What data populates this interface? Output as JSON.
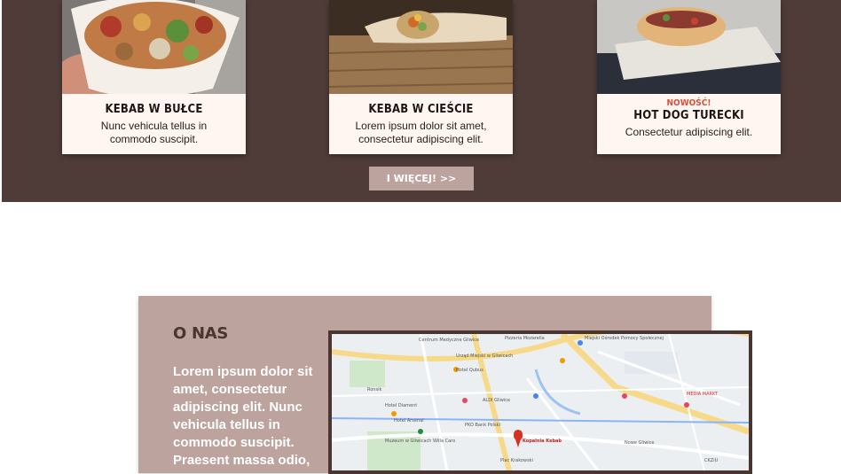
{
  "menu": {
    "cards": [
      {
        "badge": "",
        "title": "KEBAB W BUŁCE",
        "desc": "Nunc vehicula tellus in commodo suscipit."
      },
      {
        "badge": "",
        "title": "KEBAB W CIEŚCIE",
        "desc": "Lorem ipsum dolor sit amet, consectetur adipiscing elit."
      },
      {
        "badge": "NOWOŚĆ!",
        "title": "HOT DOG TURECKI",
        "desc": "Consectetur adipiscing elit."
      }
    ],
    "more_label": "I WIĘCEJ! >>"
  },
  "about": {
    "title": "O NAS",
    "text": "Lorem ipsum dolor sit amet, consectetur adipiscing elit. Nunc vehicula tellus in commodo suscipit. Praesent massa odio,"
  },
  "map": {
    "labels": [
      "Centrum Medyczne Gliwice",
      "Pizzeria Mozarella",
      "Miejski Ośrodek Pomocy Społecznej",
      "Urząd Miejski w Gliwicach",
      "Hotel Qubus",
      "Hotel Diament",
      "ALDI Gliwice",
      "PKO Bank Polski",
      "Hotel Arsenal",
      "Kopalnia Kebab",
      "Muzeum w Gliwicach Willa Caro",
      "MEDIA MARKT",
      "Plac Krakowski",
      "Nowe Gliwice",
      "Ronsik",
      "CKZiU"
    ]
  },
  "colors": {
    "section_bg": "#4f3c38",
    "card_bg": "#fff5f1",
    "button_bg": "#bca39d",
    "about_bg": "#bca39d",
    "about_title": "#4b3531",
    "badge": "#d4513d"
  }
}
